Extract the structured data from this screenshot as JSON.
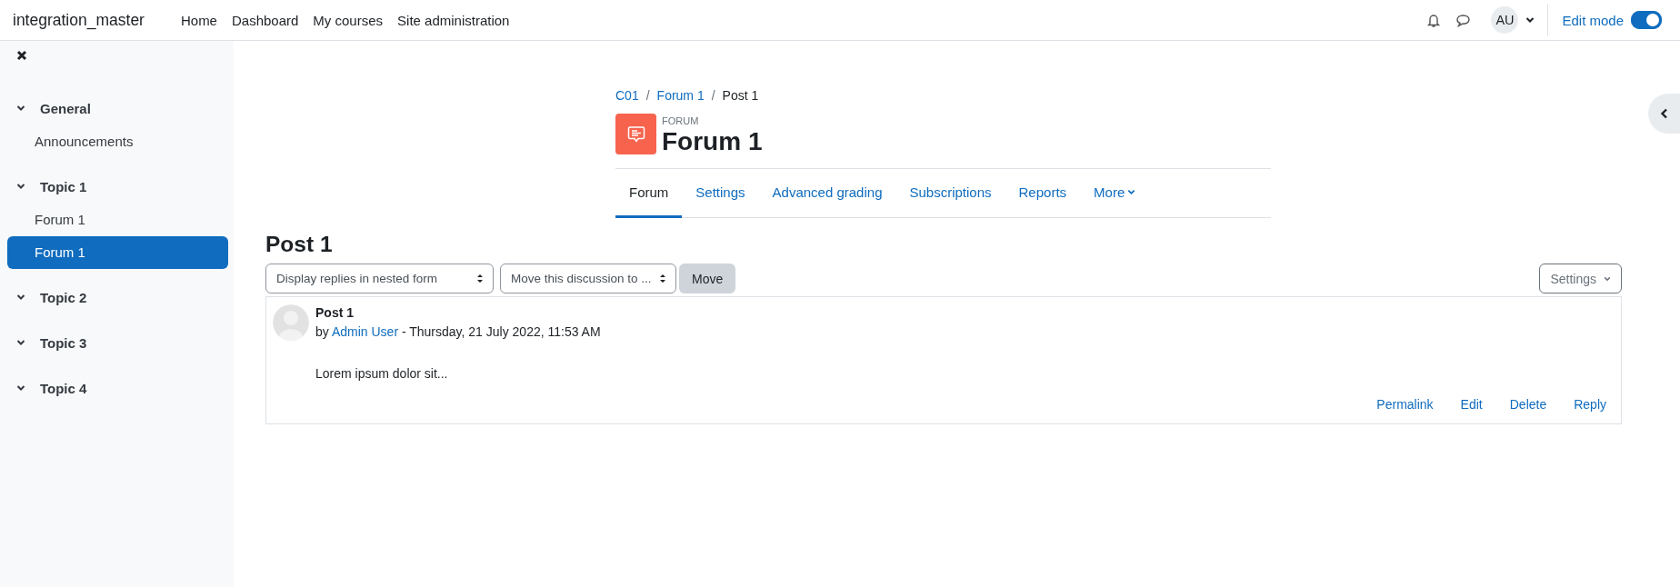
{
  "site_name": "integration_master",
  "nav": [
    "Home",
    "Dashboard",
    "My courses",
    "Site administration"
  ],
  "user": {
    "initials": "AU"
  },
  "edit_mode": {
    "label": "Edit mode",
    "on": true
  },
  "sidebar": {
    "sections": [
      {
        "title": "General",
        "expanded": true,
        "children": [
          {
            "label": "Announcements",
            "selected": false
          }
        ]
      },
      {
        "title": "Topic 1",
        "expanded": true,
        "children": [
          {
            "label": "Forum 1",
            "selected": false
          },
          {
            "label": "Forum 1",
            "selected": true
          }
        ]
      },
      {
        "title": "Topic 2",
        "expanded": true
      },
      {
        "title": "Topic 3",
        "expanded": true
      },
      {
        "title": "Topic 4",
        "expanded": true
      }
    ]
  },
  "breadcrumb": [
    {
      "label": "C01",
      "kind": "link"
    },
    {
      "label": "Forum 1",
      "kind": "link",
      "separator": "/"
    },
    {
      "label": "Post 1",
      "kind": "current",
      "separator": "/"
    }
  ],
  "activity": {
    "type_label": "FORUM",
    "title": "Forum 1"
  },
  "tabs": [
    {
      "label": "Forum",
      "selected": true,
      "kind": "tab"
    },
    {
      "label": "Settings",
      "selected": false,
      "kind": "tab"
    },
    {
      "label": "Advanced grading",
      "selected": false,
      "kind": "tab"
    },
    {
      "label": "Subscriptions",
      "selected": false,
      "kind": "tab"
    },
    {
      "label": "Reports",
      "selected": false,
      "kind": "tab"
    },
    {
      "label": "More",
      "selected": false,
      "kind": "dropdown"
    }
  ],
  "discussion": {
    "title": "Post 1",
    "display_select": "Display replies in nested form",
    "move_select": "Move this discussion to ...",
    "move_button": "Move",
    "settings_button": "Settings"
  },
  "post": {
    "subject": "Post 1",
    "by": "by",
    "author": "Admin User",
    "date": "- Thursday, 21 July 2022, 11:53 AM",
    "body": "Lorem ipsum dolor sit...",
    "actions": [
      "Permalink",
      "Edit",
      "Delete",
      "Reply"
    ]
  }
}
